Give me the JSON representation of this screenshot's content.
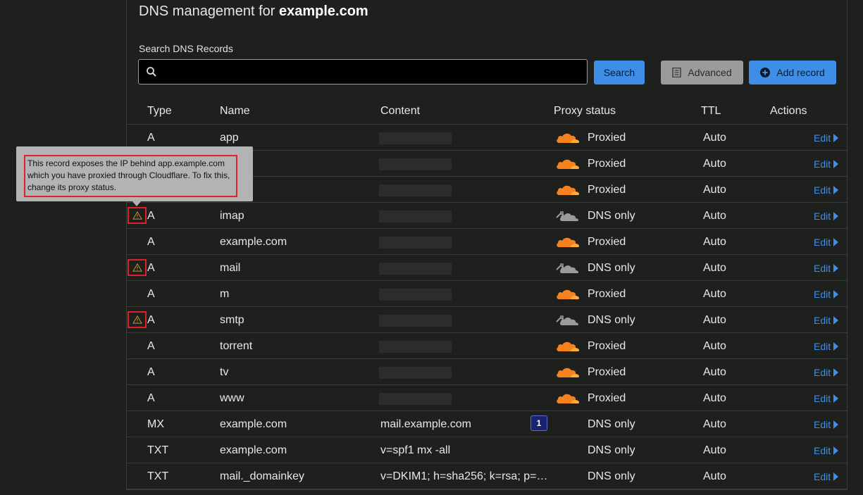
{
  "header": {
    "title_prefix": "DNS management for ",
    "title_domain": "example.com"
  },
  "search": {
    "label": "Search DNS Records",
    "value": "",
    "search_button": "Search",
    "advanced_button": "Advanced",
    "add_record_button": "Add record"
  },
  "table": {
    "columns": [
      "Type",
      "Name",
      "Content",
      "Proxy status",
      "TTL",
      "Actions"
    ],
    "edit_label": "Edit",
    "rows": [
      {
        "type": "A",
        "name": "app",
        "content": "",
        "proxy": "Proxied",
        "ttl": "Auto",
        "warning": false,
        "badge": ""
      },
      {
        "type": "A",
        "name": "",
        "content": "",
        "proxy": "Proxied",
        "ttl": "Auto",
        "warning": false,
        "badge": ""
      },
      {
        "type": "A",
        "name": "",
        "content": "",
        "proxy": "Proxied",
        "ttl": "Auto",
        "warning": false,
        "badge": ""
      },
      {
        "type": "A",
        "name": "imap",
        "content": "",
        "proxy": "DNS only",
        "ttl": "Auto",
        "warning": true,
        "badge": ""
      },
      {
        "type": "A",
        "name": "example.com",
        "content": "",
        "proxy": "Proxied",
        "ttl": "Auto",
        "warning": false,
        "badge": ""
      },
      {
        "type": "A",
        "name": "mail",
        "content": "",
        "proxy": "DNS only",
        "ttl": "Auto",
        "warning": true,
        "badge": ""
      },
      {
        "type": "A",
        "name": "m",
        "content": "",
        "proxy": "Proxied",
        "ttl": "Auto",
        "warning": false,
        "badge": ""
      },
      {
        "type": "A",
        "name": "smtp",
        "content": "",
        "proxy": "DNS only",
        "ttl": "Auto",
        "warning": true,
        "badge": ""
      },
      {
        "type": "A",
        "name": "torrent",
        "content": "",
        "proxy": "Proxied",
        "ttl": "Auto",
        "warning": false,
        "badge": ""
      },
      {
        "type": "A",
        "name": "tv",
        "content": "",
        "proxy": "Proxied",
        "ttl": "Auto",
        "warning": false,
        "badge": ""
      },
      {
        "type": "A",
        "name": "www",
        "content": "",
        "proxy": "Proxied",
        "ttl": "Auto",
        "warning": false,
        "badge": ""
      },
      {
        "type": "MX",
        "name": "example.com",
        "content": "mail.example.com",
        "proxy": "DNS only",
        "ttl": "Auto",
        "warning": false,
        "badge": "1"
      },
      {
        "type": "TXT",
        "name": "example.com",
        "content": "v=spf1 mx -all",
        "proxy": "DNS only",
        "ttl": "Auto",
        "warning": false,
        "badge": ""
      },
      {
        "type": "TXT",
        "name": "mail._domainkey",
        "content": "v=DKIM1; h=sha256; k=rsa; p=…",
        "proxy": "DNS only",
        "ttl": "Auto",
        "warning": false,
        "badge": ""
      }
    ]
  },
  "tooltip": {
    "text": "This record exposes the IP behind app.example.com which you have proxied through Cloudflare. To fix this, change its proxy status."
  },
  "colors": {
    "accent": "#3f8ee6",
    "proxied_cloud": "#f6821f",
    "dns_only_cloud": "#9b9b9b",
    "warning": "#e0212a"
  },
  "icons": {
    "search": "search-icon",
    "advanced": "document-icon",
    "add": "plus-circle-icon",
    "proxied": "orange-cloud-icon",
    "dns_only": "grey-cloud-icon",
    "warning": "warning-icon",
    "edit": "caret-right-icon"
  }
}
